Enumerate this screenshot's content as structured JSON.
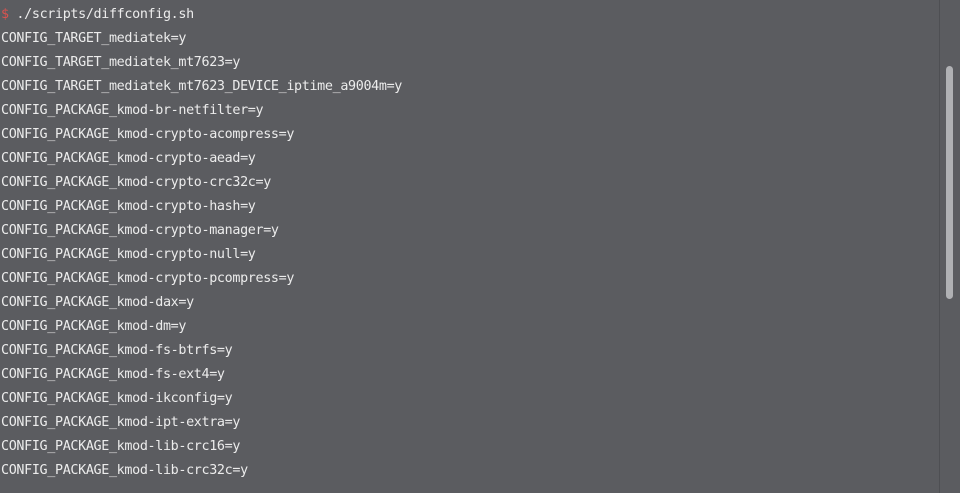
{
  "terminal": {
    "prompt": {
      "symbol": "$",
      "command": " ./scripts/diffconfig.sh"
    },
    "lines": [
      "CONFIG_TARGET_mediatek=y",
      "CONFIG_TARGET_mediatek_mt7623=y",
      "CONFIG_TARGET_mediatek_mt7623_DEVICE_iptime_a9004m=y",
      "CONFIG_PACKAGE_kmod-br-netfilter=y",
      "CONFIG_PACKAGE_kmod-crypto-acompress=y",
      "CONFIG_PACKAGE_kmod-crypto-aead=y",
      "CONFIG_PACKAGE_kmod-crypto-crc32c=y",
      "CONFIG_PACKAGE_kmod-crypto-hash=y",
      "CONFIG_PACKAGE_kmod-crypto-manager=y",
      "CONFIG_PACKAGE_kmod-crypto-null=y",
      "CONFIG_PACKAGE_kmod-crypto-pcompress=y",
      "CONFIG_PACKAGE_kmod-dax=y",
      "CONFIG_PACKAGE_kmod-dm=y",
      "CONFIG_PACKAGE_kmod-fs-btrfs=y",
      "CONFIG_PACKAGE_kmod-fs-ext4=y",
      "CONFIG_PACKAGE_kmod-ikconfig=y",
      "CONFIG_PACKAGE_kmod-ipt-extra=y",
      "CONFIG_PACKAGE_kmod-lib-crc16=y",
      "CONFIG_PACKAGE_kmod-lib-crc32c=y"
    ],
    "colors": {
      "background": "#5b5c60",
      "text": "#ececec",
      "prompt_symbol": "#d9534f",
      "scrollbar_thumb": "#b0b1b4"
    }
  }
}
